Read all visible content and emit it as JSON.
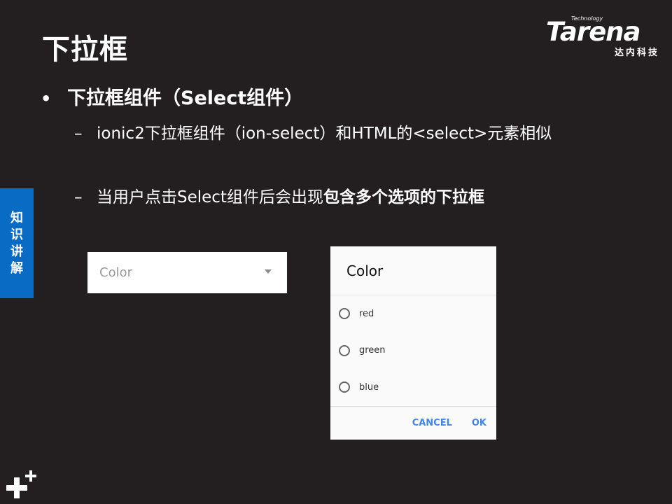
{
  "slide": {
    "title": "下拉框",
    "bullet": "下拉框组件（Select组件）",
    "sub1": "ionic2下拉框组件（ion-select）和HTML的<select>元素相似",
    "sub2_plain": "当用户点击Select组件后会出现",
    "sub2_bold": "包含多个选项的下拉框",
    "side_tab": [
      "知",
      "识",
      "讲",
      "解"
    ]
  },
  "brand": {
    "tech": "Technology",
    "name": "Tarena",
    "cn": "达内科技"
  },
  "select": {
    "label": "Color"
  },
  "dialog": {
    "title": "Color",
    "options": [
      "red",
      "green",
      "blue"
    ],
    "cancel": "CANCEL",
    "ok": "OK"
  },
  "colors": {
    "background": "#231f20",
    "side_tab": "#0a6bc5",
    "accent": "#3f86e6"
  }
}
